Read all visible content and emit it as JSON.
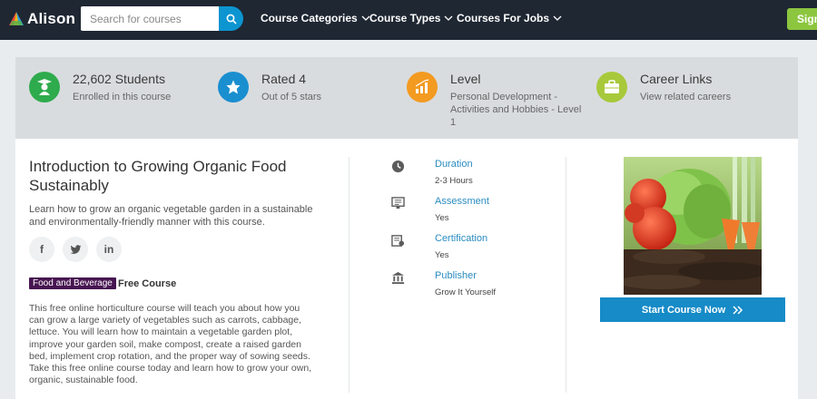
{
  "header": {
    "logo_text": "Alison",
    "search_placeholder": "Search for courses",
    "nav": [
      "Course Categories",
      "Course Types",
      "Courses For Jobs"
    ],
    "signup_label": "Sign"
  },
  "stats": [
    {
      "title": "22,602 Students",
      "sub": "Enrolled in this course",
      "icon": "graduate-icon",
      "color": "#2eab4d"
    },
    {
      "title": "Rated 4",
      "sub": "Out of 5 stars",
      "icon": "star-icon",
      "color": "#1a8fd0"
    },
    {
      "title": "Level",
      "sub": "Personal Development - Activities and Hobbies - Level 1",
      "icon": "chart-icon",
      "color": "#f39a21"
    },
    {
      "title": "Career Links",
      "sub": "View related careers",
      "icon": "briefcase-icon",
      "color": "#a8c93b"
    }
  ],
  "course": {
    "title": "Introduction to Growing Organic Food Sustainably",
    "description": "Learn how to grow an organic vegetable garden in a sustainable and environmentally-friendly manner with this course.",
    "social": [
      "f",
      "t",
      "in"
    ],
    "tag": "Food and Beverage",
    "course_type": "Free Course",
    "long_description": "This free online horticulture course will teach you about how you can grow a large variety of vegetables such as carrots, cabbage, lettuce. You will learn how to maintain a vegetable garden plot, improve your garden soil, make compost, create a raised garden bed, implement crop rotation, and the proper way of sowing seeds. Take this free online course today and learn how to grow your own, organic, sustainable food."
  },
  "details": [
    {
      "label": "Duration",
      "value": "2-3 Hours",
      "icon": "clock-icon"
    },
    {
      "label": "Assessment",
      "value": "Yes",
      "icon": "assessment-icon"
    },
    {
      "label": "Certification",
      "value": "Yes",
      "icon": "certificate-icon"
    },
    {
      "label": "Publisher",
      "value": "Grow It Yourself",
      "icon": "institution-icon"
    }
  ],
  "cta": {
    "label": "Start Course Now"
  },
  "colors": {
    "nav_bg": "#1f2733",
    "accent_blue": "#168bc7",
    "signup_green": "#8cc63f",
    "tag_purple": "#471551"
  }
}
